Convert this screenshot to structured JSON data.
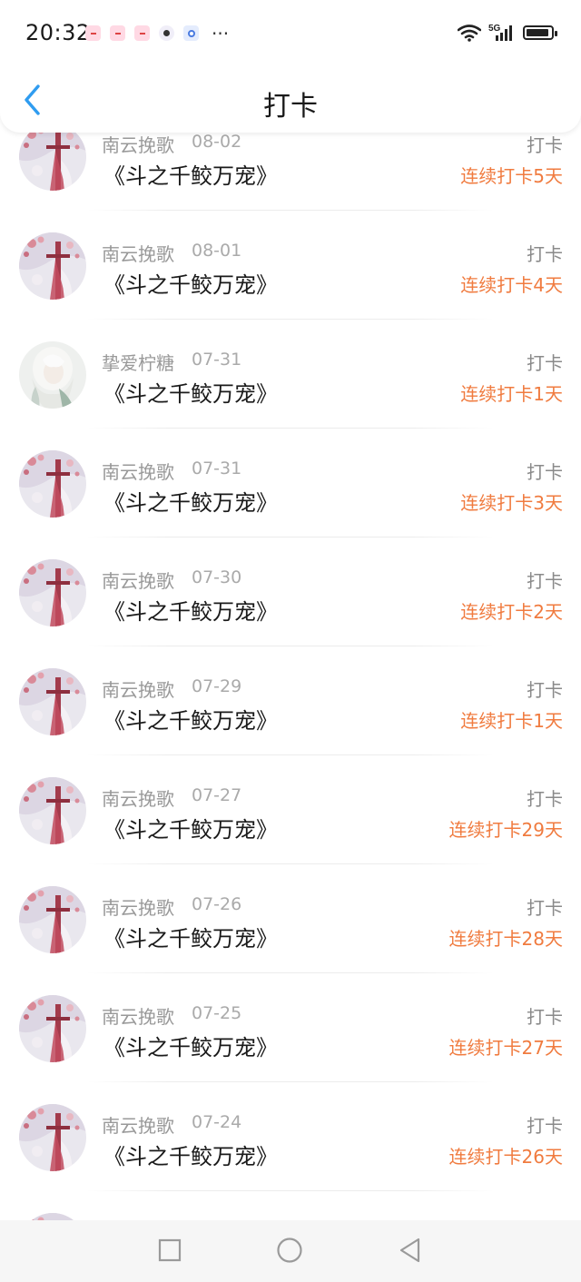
{
  "status_bar": {
    "time": "20:32",
    "more": "···",
    "network": "5G"
  },
  "header": {
    "title": "打卡"
  },
  "records": [
    {
      "name": "南云挽歌",
      "date": "08-02",
      "book": "《斗之千鲛万宠》",
      "action": "打卡",
      "streak": "连续打卡5天",
      "avatar": "sakura"
    },
    {
      "name": "南云挽歌",
      "date": "08-01",
      "book": "《斗之千鲛万宠》",
      "action": "打卡",
      "streak": "连续打卡4天",
      "avatar": "sakura"
    },
    {
      "name": "挚爱柠糖",
      "date": "07-31",
      "book": "《斗之千鲛万宠》",
      "action": "打卡",
      "streak": "连续打卡1天",
      "avatar": "white-hair"
    },
    {
      "name": "南云挽歌",
      "date": "07-31",
      "book": "《斗之千鲛万宠》",
      "action": "打卡",
      "streak": "连续打卡3天",
      "avatar": "sakura"
    },
    {
      "name": "南云挽歌",
      "date": "07-30",
      "book": "《斗之千鲛万宠》",
      "action": "打卡",
      "streak": "连续打卡2天",
      "avatar": "sakura"
    },
    {
      "name": "南云挽歌",
      "date": "07-29",
      "book": "《斗之千鲛万宠》",
      "action": "打卡",
      "streak": "连续打卡1天",
      "avatar": "sakura"
    },
    {
      "name": "南云挽歌",
      "date": "07-27",
      "book": "《斗之千鲛万宠》",
      "action": "打卡",
      "streak": "连续打卡29天",
      "avatar": "sakura"
    },
    {
      "name": "南云挽歌",
      "date": "07-26",
      "book": "《斗之千鲛万宠》",
      "action": "打卡",
      "streak": "连续打卡28天",
      "avatar": "sakura"
    },
    {
      "name": "南云挽歌",
      "date": "07-25",
      "book": "《斗之千鲛万宠》",
      "action": "打卡",
      "streak": "连续打卡27天",
      "avatar": "sakura"
    },
    {
      "name": "南云挽歌",
      "date": "07-24",
      "book": "《斗之千鲛万宠》",
      "action": "打卡",
      "streak": "连续打卡26天",
      "avatar": "sakura"
    },
    {
      "name": "",
      "date": "",
      "book": "",
      "action": "",
      "streak": "",
      "avatar": "sakura"
    }
  ],
  "colors": {
    "accent_back": "#2f9cf0",
    "streak": "#f07b3f",
    "secondary_text": "#999999"
  },
  "icons": {
    "back": "chevron-left-icon",
    "nav_recent": "square-icon",
    "nav_home": "circle-icon",
    "nav_back": "triangle-back-icon"
  }
}
